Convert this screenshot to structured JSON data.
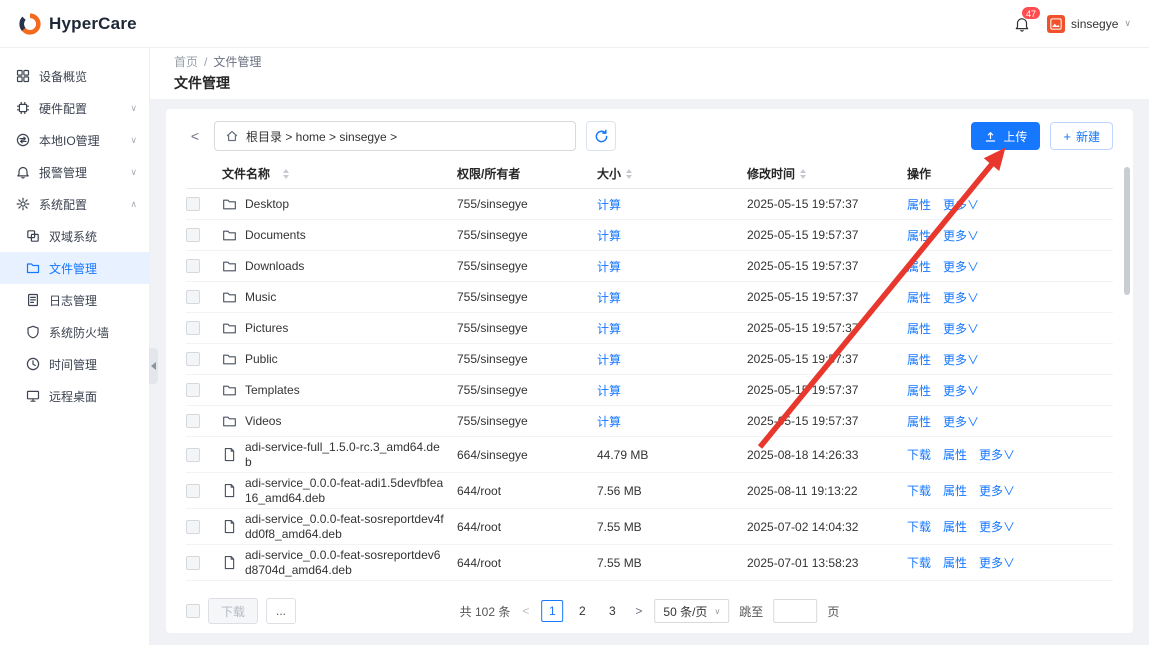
{
  "brand": {
    "name": "HyperCare"
  },
  "topbar": {
    "notification_count": "47",
    "username": "sinsegye"
  },
  "sidebar": {
    "items": [
      {
        "label": "设备概览"
      },
      {
        "label": "硬件配置"
      },
      {
        "label": "本地IO管理"
      },
      {
        "label": "报警管理"
      },
      {
        "label": "系统配置"
      }
    ],
    "subitems": [
      {
        "label": "双域系统"
      },
      {
        "label": "文件管理"
      },
      {
        "label": "日志管理"
      },
      {
        "label": "系统防火墙"
      },
      {
        "label": "时间管理"
      },
      {
        "label": "远程桌面"
      }
    ]
  },
  "breadcrumb": {
    "root": "首页",
    "sep": "/",
    "current": "文件管理"
  },
  "page": {
    "title": "文件管理"
  },
  "toolbar": {
    "path": "根目录 > home > sinsegye >",
    "upload": "上传",
    "create": "新建"
  },
  "table": {
    "headers": {
      "name": "文件名称",
      "perm": "权限/所有者",
      "size": "大小",
      "modified": "修改时间",
      "actions": "操作"
    },
    "rows": [
      {
        "type": "folder",
        "name": "Desktop",
        "perm": "755/sinsegye",
        "size": "计算",
        "size_link": true,
        "modified": "2025-05-15 19:57:37",
        "actions": [
          {
            "name": "properties",
            "label": "属性"
          },
          {
            "name": "more",
            "label": "更多∨"
          }
        ]
      },
      {
        "type": "folder",
        "name": "Documents",
        "perm": "755/sinsegye",
        "size": "计算",
        "size_link": true,
        "modified": "2025-05-15 19:57:37",
        "actions": [
          {
            "name": "properties",
            "label": "属性"
          },
          {
            "name": "more",
            "label": "更多∨"
          }
        ]
      },
      {
        "type": "folder",
        "name": "Downloads",
        "perm": "755/sinsegye",
        "size": "计算",
        "size_link": true,
        "modified": "2025-05-15 19:57:37",
        "actions": [
          {
            "name": "properties",
            "label": "属性"
          },
          {
            "name": "more",
            "label": "更多∨"
          }
        ]
      },
      {
        "type": "folder",
        "name": "Music",
        "perm": "755/sinsegye",
        "size": "计算",
        "size_link": true,
        "modified": "2025-05-15 19:57:37",
        "actions": [
          {
            "name": "properties",
            "label": "属性"
          },
          {
            "name": "more",
            "label": "更多∨"
          }
        ]
      },
      {
        "type": "folder",
        "name": "Pictures",
        "perm": "755/sinsegye",
        "size": "计算",
        "size_link": true,
        "modified": "2025-05-15 19:57:37",
        "actions": [
          {
            "name": "properties",
            "label": "属性"
          },
          {
            "name": "more",
            "label": "更多∨"
          }
        ]
      },
      {
        "type": "folder",
        "name": "Public",
        "perm": "755/sinsegye",
        "size": "计算",
        "size_link": true,
        "modified": "2025-05-15 19:57:37",
        "actions": [
          {
            "name": "properties",
            "label": "属性"
          },
          {
            "name": "more",
            "label": "更多∨"
          }
        ]
      },
      {
        "type": "folder",
        "name": "Templates",
        "perm": "755/sinsegye",
        "size": "计算",
        "size_link": true,
        "modified": "2025-05-15 19:57:37",
        "actions": [
          {
            "name": "properties",
            "label": "属性"
          },
          {
            "name": "more",
            "label": "更多∨"
          }
        ]
      },
      {
        "type": "folder",
        "name": "Videos",
        "perm": "755/sinsegye",
        "size": "计算",
        "size_link": true,
        "modified": "2025-05-15 19:57:37",
        "actions": [
          {
            "name": "properties",
            "label": "属性"
          },
          {
            "name": "more",
            "label": "更多∨"
          }
        ]
      },
      {
        "type": "file",
        "name": "adi-service-full_1.5.0-rc.3_amd64.deb",
        "perm": "664/sinsegye",
        "size": "44.79 MB",
        "size_link": false,
        "modified": "2025-08-18 14:26:33",
        "actions": [
          {
            "name": "download",
            "label": "下载"
          },
          {
            "name": "properties",
            "label": "属性"
          },
          {
            "name": "more",
            "label": "更多∨"
          }
        ]
      },
      {
        "type": "file",
        "name": "adi-service_0.0.0-feat-adi1.5devfbfea16_amd64.deb",
        "perm": "644/root",
        "size": "7.56 MB",
        "size_link": false,
        "modified": "2025-08-11 19:13:22",
        "actions": [
          {
            "name": "download",
            "label": "下载"
          },
          {
            "name": "properties",
            "label": "属性"
          },
          {
            "name": "more",
            "label": "更多∨"
          }
        ]
      },
      {
        "type": "file",
        "name": "adi-service_0.0.0-feat-sosreportdev4fdd0f8_amd64.deb",
        "perm": "644/root",
        "size": "7.55 MB",
        "size_link": false,
        "modified": "2025-07-02 14:04:32",
        "actions": [
          {
            "name": "download",
            "label": "下载"
          },
          {
            "name": "properties",
            "label": "属性"
          },
          {
            "name": "more",
            "label": "更多∨"
          }
        ]
      },
      {
        "type": "file",
        "name": "adi-service_0.0.0-feat-sosreportdev6d8704d_amd64.deb",
        "perm": "644/root",
        "size": "7.55 MB",
        "size_link": false,
        "modified": "2025-07-01 13:58:23",
        "actions": [
          {
            "name": "download",
            "label": "下载"
          },
          {
            "name": "properties",
            "label": "属性"
          },
          {
            "name": "more",
            "label": "更多∨"
          }
        ]
      }
    ]
  },
  "footer": {
    "download": "下载",
    "more": "...",
    "total": "共 102 条",
    "pages": [
      "1",
      "2",
      "3"
    ],
    "active_page": "1",
    "page_size": "50 条/页",
    "jump_label": "跳至",
    "jump_unit": "页"
  },
  "colors": {
    "primary": "#1677ff",
    "badge": "#ff4d4f",
    "annotation_arrow": "#e8382d",
    "brand_orange": "#f46a1f"
  }
}
